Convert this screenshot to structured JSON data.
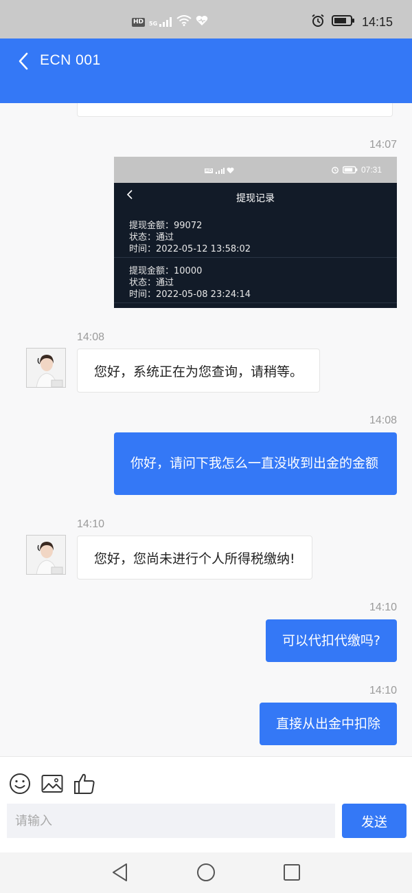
{
  "status_bar": {
    "time": "14:15",
    "hd": "HD",
    "network": "5G",
    "icons": [
      "hd-icon",
      "signal-icon",
      "wifi-icon",
      "heart-icon",
      "alarm-icon",
      "battery-icon"
    ]
  },
  "header": {
    "title": "ECN 001",
    "back_icon": "chevron-left-icon",
    "color": "#3478f6"
  },
  "messages": [
    {
      "side": "right",
      "time": "14:07",
      "type": "image",
      "screenshot": {
        "status_time": "07:31",
        "title": "提现记录",
        "records": [
          {
            "amount": "提现金额：99072",
            "status": "状态：通过",
            "time": "时间：2022-05-12 13:58:02"
          },
          {
            "amount": "提现金额：10000",
            "status": "状态：通过",
            "time": "时间：2022-05-08 23:24:14"
          }
        ]
      }
    },
    {
      "side": "left",
      "time": "14:08",
      "type": "text",
      "text": "您好，系统正在为您查询，请稍等。"
    },
    {
      "side": "right",
      "time": "14:08",
      "type": "text",
      "text": "你好，请问下我怎么一直没收到出金的金额"
    },
    {
      "side": "left",
      "time": "14:10",
      "type": "text",
      "text": "您好，您尚未进行个人所得税缴纳!"
    },
    {
      "side": "right",
      "time": "14:10",
      "type": "text",
      "text": "可以代扣代缴吗?"
    },
    {
      "side": "right",
      "time": "14:10",
      "type": "text",
      "text": "直接从出金中扣除"
    }
  ],
  "composer": {
    "placeholder": "请输入",
    "send_label": "发送",
    "tools": [
      "emoji-icon",
      "image-icon",
      "thumbs-up-icon"
    ]
  },
  "nav_bar": {
    "buttons": [
      "back-triangle-icon",
      "home-circle-icon",
      "recents-square-icon"
    ]
  }
}
